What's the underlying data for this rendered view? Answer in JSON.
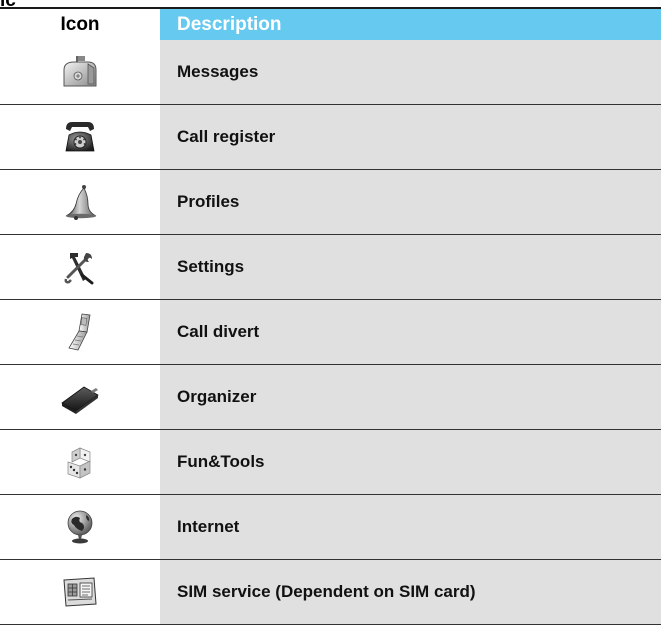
{
  "header": {
    "partial_title": "ic",
    "col_icon": "Icon",
    "col_description": "Description"
  },
  "rows": [
    {
      "icon": "mailbox-icon",
      "label": "Messages"
    },
    {
      "icon": "rotary-telephone-icon",
      "label": "Call register"
    },
    {
      "icon": "bell-icon",
      "label": "Profiles"
    },
    {
      "icon": "hammer-wrench-icon",
      "label": "Settings"
    },
    {
      "icon": "flip-phone-icon",
      "label": "Call divert"
    },
    {
      "icon": "organizer-book-icon",
      "label": "Organizer"
    },
    {
      "icon": "dice-icon",
      "label": "Fun&Tools"
    },
    {
      "icon": "globe-icon",
      "label": "Internet"
    },
    {
      "icon": "sim-card-icon",
      "label": "SIM service (Dependent on SIM card)"
    }
  ],
  "colors": {
    "header_accent": "#66c9f0",
    "description_background": "#e0e0e0",
    "rule": "#1a1a1a"
  }
}
